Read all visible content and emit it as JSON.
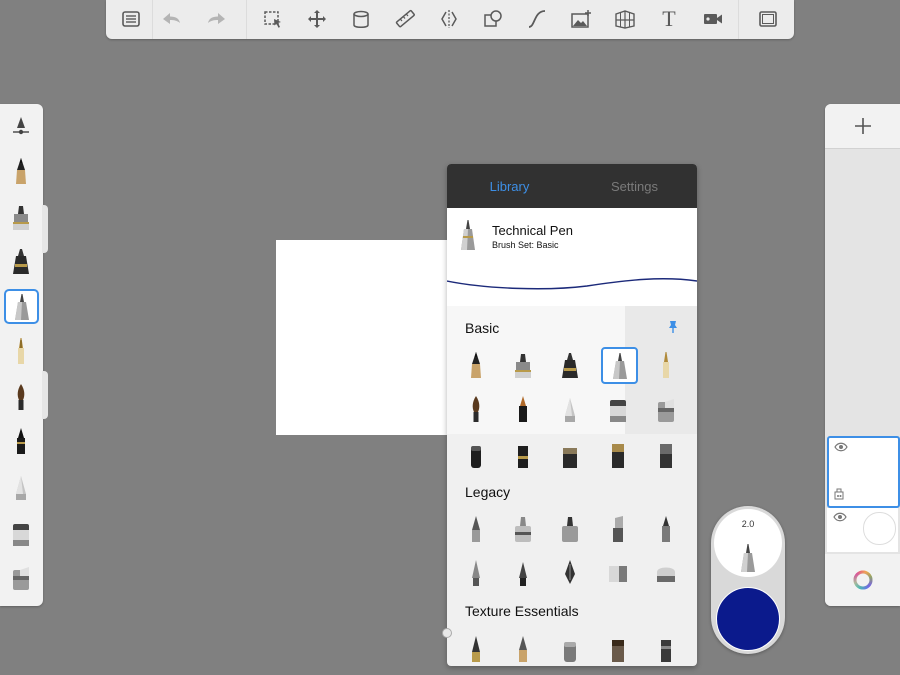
{
  "toolbar": {
    "buttons": [
      {
        "name": "gallery-icon"
      },
      {
        "name": "undo-icon",
        "disabled": true
      },
      {
        "name": "redo-icon",
        "disabled": true
      },
      {
        "name": "selection-icon"
      },
      {
        "name": "transform-icon"
      },
      {
        "name": "fill-icon"
      },
      {
        "name": "ruler-icon"
      },
      {
        "name": "symmetry-icon"
      },
      {
        "name": "shapes-icon"
      },
      {
        "name": "curve-icon"
      },
      {
        "name": "image-icon"
      },
      {
        "name": "perspective-icon"
      },
      {
        "name": "text-icon"
      },
      {
        "name": "record-icon"
      },
      {
        "name": "fullscreen-icon"
      }
    ],
    "text_glyph": "T"
  },
  "brush_library": {
    "tabs": [
      "Library",
      "Settings"
    ],
    "active_tab": "Library",
    "current_brush": {
      "name": "Technical Pen",
      "set": "Brush Set: Basic"
    },
    "sections": [
      {
        "title": "Basic"
      },
      {
        "title": "Legacy"
      },
      {
        "title": "Texture Essentials"
      }
    ],
    "pin_icon": "pin-icon"
  },
  "puck": {
    "size_value": "2.0"
  },
  "colors": {
    "accent": "#3d8fe6",
    "current_color": "#0b1a8c",
    "stroke_preview": "#1c2a7a",
    "background": "#808080"
  }
}
